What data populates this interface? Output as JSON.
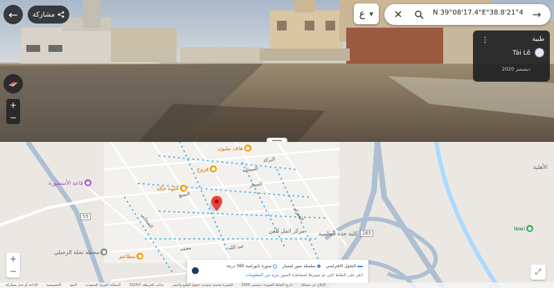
{
  "streetview": {
    "share_label": "مشاركة",
    "language_label": "ع",
    "search": {
      "value": "N 39°08'17.4\"E\"38.8'21°47"
    },
    "photo_card": {
      "title": "طبية",
      "author": "Tài Lê",
      "date": "ديسمبر 2020"
    }
  },
  "map": {
    "labels": {
      "hafi": "هاف مليون",
      "forouj": "فروج",
      "hilwa": "حلوة خالد",
      "qaa": "قاعة الأسطورة",
      "taj": "مطاعم",
      "school": "مركز اتمل الفن",
      "college": "كلية جدة العالمية",
      "station": "محطة نحلة الرحيلي",
      "ahlia": "الأهلية",
      "iewi": "Iewi",
      "road265": "265",
      "road55": "55"
    },
    "streets": [
      "السبع",
      "الصحابة",
      "عبد الله",
      "محمد",
      "الحجاز",
      "الغفران",
      "الصحابي",
      "البركة"
    ],
    "legend": {
      "item_virtual": "التجول الافتراضي",
      "item_line": "سلسلة صور لمسار",
      "item_panorama": "صورة بانورامية 360 درجة",
      "hint_text": "انقر على النقاط التي تم تمييزها لمشاهدة الصور",
      "hint_link": "مزيد من المعلومات"
    },
    "footer": [
      "الإذاعة أو خيار مشاركة",
      "الخصوصية",
      "البنود",
      "المملكة العربية السعودية",
      "بيانات الخريطة ©2024",
      "الصورة محمية بموجب حقوق الطبع والنشر",
      "تاريخ التقاط الصورة: ديسمبر 2020",
      "الإبلاغ عن مشكلة"
    ]
  },
  "colors": {
    "pin": "#ea4335",
    "sv_blue": "#4285f4",
    "poi_orange": "#f29900"
  }
}
